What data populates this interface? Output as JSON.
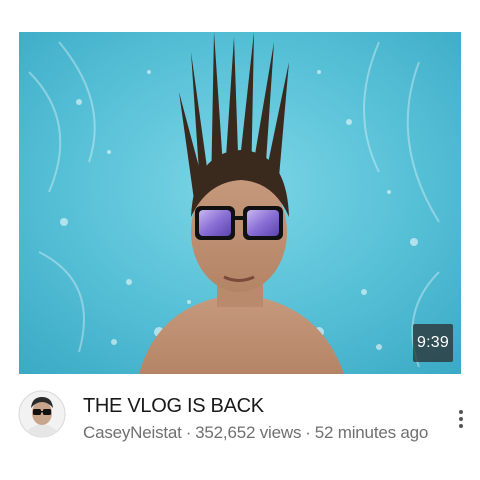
{
  "video": {
    "title": "THE VLOG IS BACK",
    "duration": "9:39",
    "channel": "CaseyNeistat",
    "views": "352,652 views",
    "age": "52 minutes ago",
    "separator": "·"
  },
  "thumbnail": {
    "scene": "underwater-pool-selfie",
    "water_color": "#5cc4d8"
  },
  "icons": {
    "menu": "more-vert-icon",
    "avatar": "channel-avatar"
  }
}
